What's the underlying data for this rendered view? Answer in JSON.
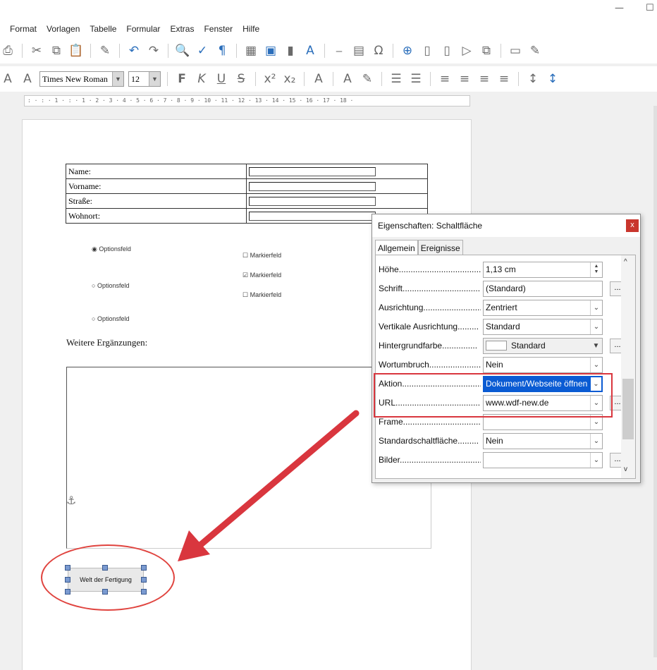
{
  "window": {
    "minimize_glyph": "—",
    "maximize_glyph": "☐"
  },
  "menu": [
    "Format",
    "Vorlagen",
    "Tabelle",
    "Formular",
    "Extras",
    "Fenster",
    "Hilfe"
  ],
  "font_toolbar": {
    "font_name": "Times New Roman",
    "font_size": "12"
  },
  "ruler": {
    "text": ": · : · 1 · : · 1 · 2 · 3 · 4 · 5 · 6 · 7 · 8 · 9 · 10 · 11 · 12 · 13 · 14 · 15 · 16 · 17 · 18 ·"
  },
  "form": {
    "rows": [
      {
        "label": "Name:"
      },
      {
        "label": "Vorname:"
      },
      {
        "label": "Straße:"
      },
      {
        "label": "Wohnort:"
      }
    ],
    "option_fields": [
      "Optionsfeld",
      "Optionsfeld",
      "Optionsfeld"
    ],
    "checkboxes": [
      {
        "label": "Markierfeld",
        "checked": false
      },
      {
        "label": "Markierfeld",
        "checked": true
      },
      {
        "label": "Markierfeld",
        "checked": false
      }
    ],
    "further_heading": "Weitere Ergänzungen:",
    "push_button_label": "Welt der Fertigung"
  },
  "dialog": {
    "title": "Eigenschaften: Schaltfläche",
    "close_glyph": "x",
    "tabs": [
      "Allgemein",
      "Ereignisse"
    ],
    "properties": [
      {
        "label": "Höhe.....................................",
        "value": "1,13 cm",
        "control": "spin"
      },
      {
        "label": "Schrift...................................",
        "value": "(Standard)",
        "control": "button"
      },
      {
        "label": "Ausrichtung..........................",
        "value": "Zentriert",
        "control": "dropdown"
      },
      {
        "label": "Vertikale Ausrichtung.........",
        "value": "Standard",
        "control": "dropdown"
      },
      {
        "label": "Hintergrundfarbe...............",
        "value": "Standard",
        "control": "color"
      },
      {
        "label": "Wortumbruch.......................",
        "value": "Nein",
        "control": "dropdown"
      },
      {
        "label": "Aktion....................................",
        "value": "Dokument/Webseite öffnen",
        "control": "dropdown-selected"
      },
      {
        "label": "URL.......................................",
        "value": "www.wdf-new.de",
        "control": "dropdown-button"
      },
      {
        "label": "Frame....................................",
        "value": "",
        "control": "dropdown"
      },
      {
        "label": "Standardschaltfläche.........",
        "value": "Nein",
        "control": "dropdown"
      },
      {
        "label": "Bilder....................................",
        "value": "",
        "control": "dropdown-button"
      }
    ],
    "dots_label": "...",
    "dropdown_glyph": "⌄"
  }
}
